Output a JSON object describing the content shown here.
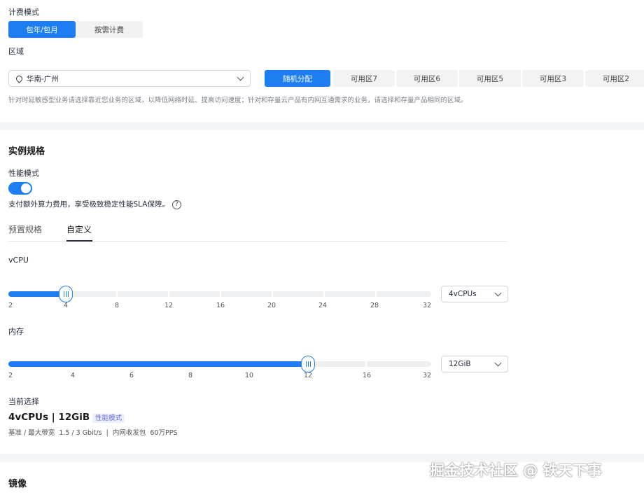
{
  "billing": {
    "label": "计费模式",
    "options": [
      "包年/包月",
      "按需计费"
    ],
    "selected": "包年/包月"
  },
  "region": {
    "label": "区域",
    "value": "华南-广州",
    "az_options": [
      "随机分配",
      "可用区7",
      "可用区6",
      "可用区5",
      "可用区3",
      "可用区2"
    ],
    "az_selected": "随机分配",
    "hint": "针对时延敏感型业务请选择靠近您业务的区域，以降低网络时延、提高访问速度；针对和存量云产品有内网互通需求的业务，请选择和存量产品相同的区域。"
  },
  "spec": {
    "title": "实例规格",
    "perf_mode_label": "性能模式",
    "perf_mode_on": true,
    "perf_mode_desc": "支付额外算力费用，享受极致稳定性能SLA保障。",
    "tabs": [
      "预置规格",
      "自定义"
    ],
    "active_tab": "自定义",
    "vcpu": {
      "label": "vCPU",
      "ticks": [
        "2",
        "4",
        "8",
        "12",
        "16",
        "20",
        "24",
        "28",
        "32"
      ],
      "value": "4vCPUs",
      "selected_tick_index": 1
    },
    "memory": {
      "label": "内存",
      "ticks": [
        "2",
        "4",
        "6",
        "8",
        "10",
        "12",
        "16",
        "32"
      ],
      "value": "12GiB",
      "selected_tick_index": 5
    },
    "current": {
      "label": "当前选择",
      "summary": "4vCPUs | 12GiB",
      "badge": "性能模式",
      "detail": "基准 / 最大带宽  1.5 / 3 Gbit/s  |  内网收发包  60万PPS"
    }
  },
  "image": {
    "title": "镜像"
  },
  "watermark": "掘金技术社区 @ 铁天下事",
  "colors": {
    "accent": "#1c7ef0"
  }
}
